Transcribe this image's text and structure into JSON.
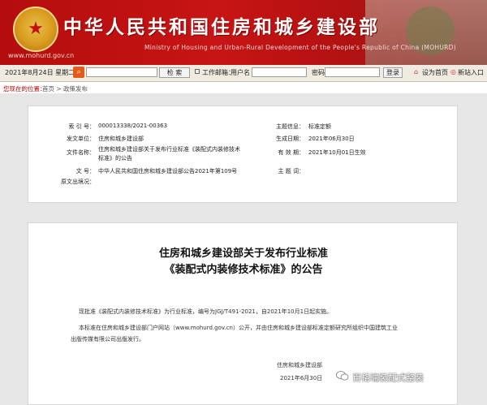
{
  "header": {
    "title": "中华人民共和国住房和城乡建设部",
    "subtitle": "Ministry of Housing and Urban-Rural Development of the People's Republic of China (MOHURD)",
    "domain": "www.mohurd.gov.cn",
    "emblem_icon": "national-emblem-icon"
  },
  "toolbar": {
    "date": "2021年8月24日 星期二",
    "search_button": "检 索",
    "platform_label": "工作邮箱：",
    "username_label": "用户名",
    "password_label": "密码",
    "login_button": "登录",
    "homepage_link": "设为首页",
    "new_window_link": "新站入口"
  },
  "breadcrumb": {
    "label": "您现在的位置：",
    "path": "首页 > 政策发布"
  },
  "info": {
    "index_label": "索 引 号：",
    "index_value": "000013338/2021-00363",
    "issuer_label": "发文单位：",
    "issuer_value": "住房和城乡建设部",
    "docname_label": "文件名称：",
    "docname_value_1": "住房和城乡建设部关于发布行业标准《装配式内装修技术",
    "docname_value_2": "标准》的公告",
    "docno_label": "文    号：",
    "docno_value": "中华人民共和国住房和城乡建设部公告2021年第109号",
    "source_label": "原文出境况：",
    "topic_label": "主题信息：",
    "topic_value": "标准定额",
    "date_label": "生成日期：",
    "date_value": "2021年06月30日",
    "valid_label": "有 效 期：",
    "valid_value": "2021年10月01日生效",
    "subject_label": "主 题 词："
  },
  "document": {
    "title_1": "住房和城乡建设部关于发布行业标准",
    "title_2": "《装配式内装修技术标准》的公告",
    "para_1": "现批准《装配式内装修技术标准》为行业标准，编号为JGJ/T491-2021，自2021年10月1日起实施。",
    "para_2a": "本标准在住房和城乡建设部门户网站（www.mohurd.gov.cn）公开，并由住房和城乡建设部标准定额研究所组织中国建筑工业",
    "para_2b": "出版传媒有限公司出版发行。",
    "signature": "住房和城乡建设部",
    "sign_date": "2021年6月30日"
  },
  "watermark": {
    "text": "百格瑞装配式整装"
  }
}
